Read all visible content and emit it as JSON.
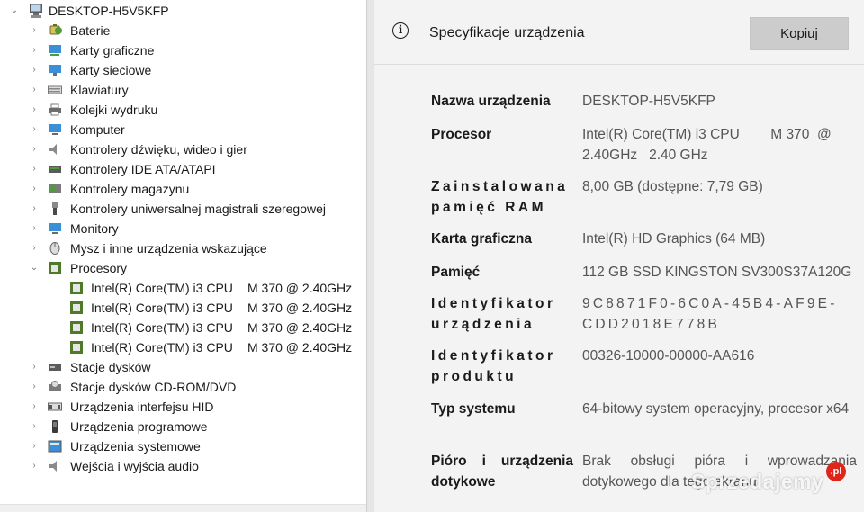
{
  "tree": {
    "root_label": "DESKTOP-H5V5KFP",
    "categories": [
      {
        "label": "Baterie",
        "icon": "battery-icon"
      },
      {
        "label": "Karty graficzne",
        "icon": "display-adapter-icon"
      },
      {
        "label": "Karty sieciowe",
        "icon": "network-adapter-icon"
      },
      {
        "label": "Klawiatury",
        "icon": "keyboard-icon"
      },
      {
        "label": "Kolejki wydruku",
        "icon": "printer-icon"
      },
      {
        "label": "Komputer",
        "icon": "computer-icon"
      },
      {
        "label": "Kontrolery dźwięku, wideo i gier",
        "icon": "speaker-icon"
      },
      {
        "label": "Kontrolery IDE ATA/ATAPI",
        "icon": "ide-controller-icon"
      },
      {
        "label": "Kontrolery magazynu",
        "icon": "storage-controller-icon"
      },
      {
        "label": "Kontrolery uniwersalnej magistrali szeregowej",
        "icon": "usb-icon"
      },
      {
        "label": "Monitory",
        "icon": "monitor-icon"
      },
      {
        "label": "Mysz i inne urządzenia wskazujące",
        "icon": "mouse-icon"
      },
      {
        "label": "Procesory",
        "icon": "processor-icon",
        "expanded": true
      }
    ],
    "processors": [
      {
        "name": "Intel(R) Core(TM) i3 CPU",
        "freq": "M 370  @ 2.40GHz"
      },
      {
        "name": "Intel(R) Core(TM) i3 CPU",
        "freq": "M 370  @ 2.40GHz"
      },
      {
        "name": "Intel(R) Core(TM) i3 CPU",
        "freq": "M 370  @ 2.40GHz"
      },
      {
        "name": "Intel(R) Core(TM) i3 CPU",
        "freq": "M 370  @ 2.40GHz"
      }
    ],
    "categories_after": [
      {
        "label": "Stacje dysków",
        "icon": "disk-drive-icon"
      },
      {
        "label": "Stacje dysków CD-ROM/DVD",
        "icon": "cdrom-icon"
      },
      {
        "label": "Urządzenia interfejsu HID",
        "icon": "hid-icon"
      },
      {
        "label": "Urządzenia programowe",
        "icon": "software-device-icon"
      },
      {
        "label": "Urządzenia systemowe",
        "icon": "system-device-icon"
      },
      {
        "label": "Wejścia i wyjścia audio",
        "icon": "audio-io-icon"
      }
    ]
  },
  "spec": {
    "title": "Specyfikacje urządzenia",
    "copy_label": "Kopiuj",
    "rows": [
      {
        "label": "Nazwa urządzenia",
        "value": "DESKTOP-H5V5KFP"
      },
      {
        "label": "Procesor",
        "value": "Intel(R) Core(TM) i3 CPU        M 370  @\n2.40GHz   2.40 GHz"
      },
      {
        "label": "Zainstalowana pamięć RAM",
        "value": "8,00 GB (dostępne: 7,79 GB)"
      },
      {
        "label": "Karta graficzna",
        "value": "Intel(R) HD Graphics (64 MB)"
      },
      {
        "label": "Pamięć",
        "value": "112 GB SSD KINGSTON SV300S37A120G"
      },
      {
        "label": "Identyfikator urządzenia",
        "value": "9C8871F0-6C0A-45B4-AF9E-\nCDD2018E778B"
      },
      {
        "label": "Identyfikator produktu",
        "value": "00326-10000-00000-AA616"
      },
      {
        "label": "Typ systemu",
        "value": "64-bitowy system operacyjny, procesor x64"
      },
      {
        "label": "Pióro i urządzenia dotykowe",
        "value": "Brak obsługi pióra i wprowadzania dotykowego dla tego ekranu"
      }
    ]
  },
  "watermark": {
    "text": "Sprzedajemy",
    "badge": ".pl"
  },
  "colors": {
    "accent_processor": "#4e7a2a",
    "button_bg": "#cccccc",
    "panel_bg": "#f3f3f3",
    "watermark_badge": "#e0251b"
  }
}
